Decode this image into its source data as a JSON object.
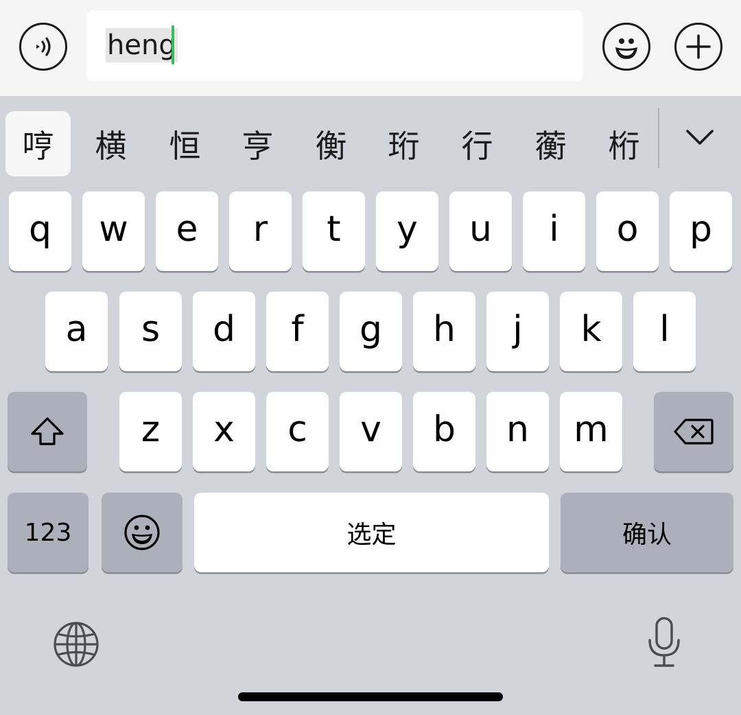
{
  "input_bar": {
    "composing_text": "heng",
    "voice_icon": "voice-icon",
    "emoji_icon": "emoji-icon",
    "add_icon": "plus-icon"
  },
  "candidates": [
    "哼",
    "横",
    "恒",
    "亨",
    "衡",
    "珩",
    "行",
    "蘅",
    "桁"
  ],
  "candidate_expand_icon": "chevron-down-icon",
  "keyboard": {
    "row1": [
      "q",
      "w",
      "e",
      "r",
      "t",
      "y",
      "u",
      "i",
      "o",
      "p"
    ],
    "row2": [
      "a",
      "s",
      "d",
      "f",
      "g",
      "h",
      "j",
      "k",
      "l"
    ],
    "row3": [
      "z",
      "x",
      "c",
      "v",
      "b",
      "n",
      "m"
    ],
    "shift_icon": "shift-icon",
    "delete_icon": "backspace-icon",
    "numbers_label": "123",
    "emoji_key_icon": "emoji-icon",
    "space_label": "选定",
    "return_label": "确认",
    "globe_icon": "globe-icon",
    "mic_icon": "microphone-icon"
  },
  "colors": {
    "caret": "#3cb95a",
    "keyboard_bg": "#d1d4db",
    "key_bg": "#ffffff",
    "function_key_bg": "#abb0bb"
  }
}
